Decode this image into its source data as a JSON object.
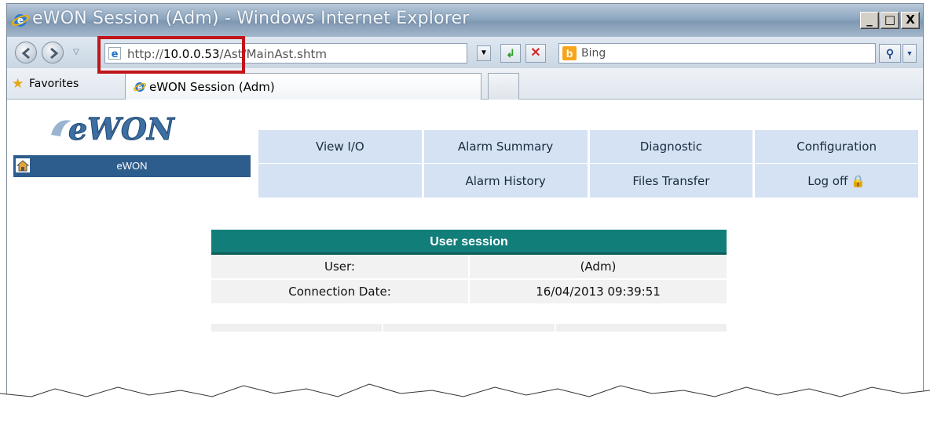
{
  "window": {
    "title": "eWON Session (Adm) - Windows Internet Explorer",
    "min_glyph": "_",
    "max_glyph": "□",
    "close_glyph": "X"
  },
  "address_bar": {
    "url_prefix": "http://",
    "url_host": "10.0.0.53",
    "url_path": "/Ast/MainAst.shtm",
    "search_placeholder": "Bing",
    "highlight_color": "#c0151a"
  },
  "favorites_bar": {
    "label": "Favorites",
    "active_tab": "eWON Session (Adm)"
  },
  "sidebar": {
    "logo_text": "eWON",
    "home_label": "eWON"
  },
  "menu": {
    "row1": [
      "View I/O",
      "Alarm Summary",
      "Diagnostic",
      "Configuration"
    ],
    "row2": [
      "",
      "Alarm History",
      "Files Transfer",
      "Log off"
    ]
  },
  "session": {
    "title": "User session",
    "rows": [
      {
        "label": "User:",
        "value": "(Adm)"
      },
      {
        "label": "Connection Date:",
        "value": "16/04/2013 09:39:51"
      }
    ]
  },
  "colors": {
    "menu_bg": "#d4e2f3",
    "home_bar": "#2d5d8c",
    "session_header": "#127e7a"
  }
}
